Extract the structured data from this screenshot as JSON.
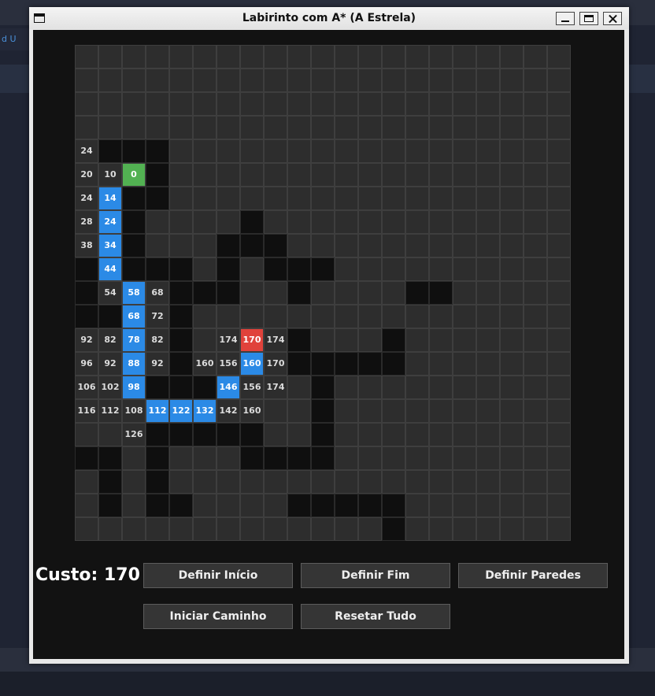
{
  "background": {
    "tab_text": "d U"
  },
  "window": {
    "title": "Labirinto com A* (A Estrela)"
  },
  "grid": {
    "cols": 21,
    "rows": 21,
    "walls": [
      [
        4,
        1
      ],
      [
        4,
        2
      ],
      [
        4,
        3
      ],
      [
        5,
        3
      ],
      [
        6,
        2
      ],
      [
        6,
        3
      ],
      [
        7,
        2
      ],
      [
        8,
        2
      ],
      [
        9,
        2
      ],
      [
        7,
        7
      ],
      [
        8,
        6
      ],
      [
        8,
        7
      ],
      [
        8,
        8
      ],
      [
        9,
        0
      ],
      [
        9,
        3
      ],
      [
        9,
        4
      ],
      [
        9,
        6
      ],
      [
        9,
        8
      ],
      [
        9,
        9
      ],
      [
        9,
        10
      ],
      [
        10,
        0
      ],
      [
        10,
        4
      ],
      [
        10,
        5
      ],
      [
        10,
        6
      ],
      [
        10,
        9
      ],
      [
        10,
        14
      ],
      [
        10,
        15
      ],
      [
        11,
        0
      ],
      [
        11,
        1
      ],
      [
        11,
        4
      ],
      [
        12,
        4
      ],
      [
        12,
        9
      ],
      [
        12,
        13
      ],
      [
        13,
        4
      ],
      [
        13,
        9
      ],
      [
        13,
        10
      ],
      [
        13,
        11
      ],
      [
        13,
        12
      ],
      [
        13,
        13
      ],
      [
        14,
        3
      ],
      [
        14,
        4
      ],
      [
        14,
        5
      ],
      [
        14,
        10
      ],
      [
        15,
        10
      ],
      [
        16,
        3
      ],
      [
        16,
        4
      ],
      [
        16,
        5
      ],
      [
        16,
        6
      ],
      [
        16,
        7
      ],
      [
        16,
        10
      ],
      [
        17,
        0
      ],
      [
        17,
        1
      ],
      [
        17,
        3
      ],
      [
        17,
        7
      ],
      [
        17,
        8
      ],
      [
        17,
        9
      ],
      [
        17,
        10
      ],
      [
        18,
        1
      ],
      [
        18,
        3
      ],
      [
        19,
        1
      ],
      [
        19,
        3
      ],
      [
        19,
        4
      ],
      [
        19,
        9
      ],
      [
        19,
        10
      ],
      [
        19,
        11
      ],
      [
        19,
        12
      ],
      [
        19,
        13
      ],
      [
        20,
        13
      ]
    ],
    "labels": [
      {
        "r": 4,
        "c": 0,
        "t": "24"
      },
      {
        "r": 5,
        "c": 0,
        "t": "20"
      },
      {
        "r": 5,
        "c": 1,
        "t": "10"
      },
      {
        "r": 5,
        "c": 2,
        "t": "0",
        "k": "start"
      },
      {
        "r": 6,
        "c": 0,
        "t": "24"
      },
      {
        "r": 6,
        "c": 1,
        "t": "14",
        "k": "path"
      },
      {
        "r": 7,
        "c": 0,
        "t": "28"
      },
      {
        "r": 7,
        "c": 1,
        "t": "24",
        "k": "path"
      },
      {
        "r": 8,
        "c": 0,
        "t": "38"
      },
      {
        "r": 8,
        "c": 1,
        "t": "34",
        "k": "path"
      },
      {
        "r": 9,
        "c": 1,
        "t": "44",
        "k": "path"
      },
      {
        "r": 10,
        "c": 1,
        "t": "54"
      },
      {
        "r": 10,
        "c": 2,
        "t": "58",
        "k": "path"
      },
      {
        "r": 10,
        "c": 3,
        "t": "68"
      },
      {
        "r": 11,
        "c": 2,
        "t": "68",
        "k": "path"
      },
      {
        "r": 11,
        "c": 3,
        "t": "72"
      },
      {
        "r": 12,
        "c": 0,
        "t": "92"
      },
      {
        "r": 12,
        "c": 1,
        "t": "82"
      },
      {
        "r": 12,
        "c": 2,
        "t": "78",
        "k": "path"
      },
      {
        "r": 12,
        "c": 3,
        "t": "82"
      },
      {
        "r": 12,
        "c": 6,
        "t": "174"
      },
      {
        "r": 12,
        "c": 7,
        "t": "170",
        "k": "end"
      },
      {
        "r": 12,
        "c": 8,
        "t": "174"
      },
      {
        "r": 13,
        "c": 0,
        "t": "96"
      },
      {
        "r": 13,
        "c": 1,
        "t": "92"
      },
      {
        "r": 13,
        "c": 2,
        "t": "88",
        "k": "path"
      },
      {
        "r": 13,
        "c": 3,
        "t": "92"
      },
      {
        "r": 13,
        "c": 5,
        "t": "160"
      },
      {
        "r": 13,
        "c": 6,
        "t": "156"
      },
      {
        "r": 13,
        "c": 7,
        "t": "160",
        "k": "path"
      },
      {
        "r": 13,
        "c": 8,
        "t": "170"
      },
      {
        "r": 14,
        "c": 0,
        "t": "106"
      },
      {
        "r": 14,
        "c": 1,
        "t": "102"
      },
      {
        "r": 14,
        "c": 2,
        "t": "98",
        "k": "path"
      },
      {
        "r": 14,
        "c": 6,
        "t": "146",
        "k": "path"
      },
      {
        "r": 14,
        "c": 7,
        "t": "156"
      },
      {
        "r": 14,
        "c": 8,
        "t": "174"
      },
      {
        "r": 15,
        "c": 0,
        "t": "116"
      },
      {
        "r": 15,
        "c": 1,
        "t": "112"
      },
      {
        "r": 15,
        "c": 2,
        "t": "108"
      },
      {
        "r": 15,
        "c": 3,
        "t": "112",
        "k": "path"
      },
      {
        "r": 15,
        "c": 4,
        "t": "122",
        "k": "path"
      },
      {
        "r": 15,
        "c": 5,
        "t": "132",
        "k": "path"
      },
      {
        "r": 15,
        "c": 6,
        "t": "142"
      },
      {
        "r": 15,
        "c": 7,
        "t": "160"
      },
      {
        "r": 16,
        "c": 2,
        "t": "126"
      }
    ]
  },
  "cost": {
    "label": "Custo: 170"
  },
  "buttons": {
    "set_start": "Definir Início",
    "set_end": "Definir Fim",
    "set_walls": "Definir Paredes",
    "start_path": "Iniciar Caminho",
    "reset_all": "Resetar Tudo"
  },
  "colors": {
    "cell": "#2d2d2d",
    "wall": "#0f0f0f",
    "path": "#2b8ae6",
    "start": "#52b152",
    "end": "#e0423b"
  }
}
